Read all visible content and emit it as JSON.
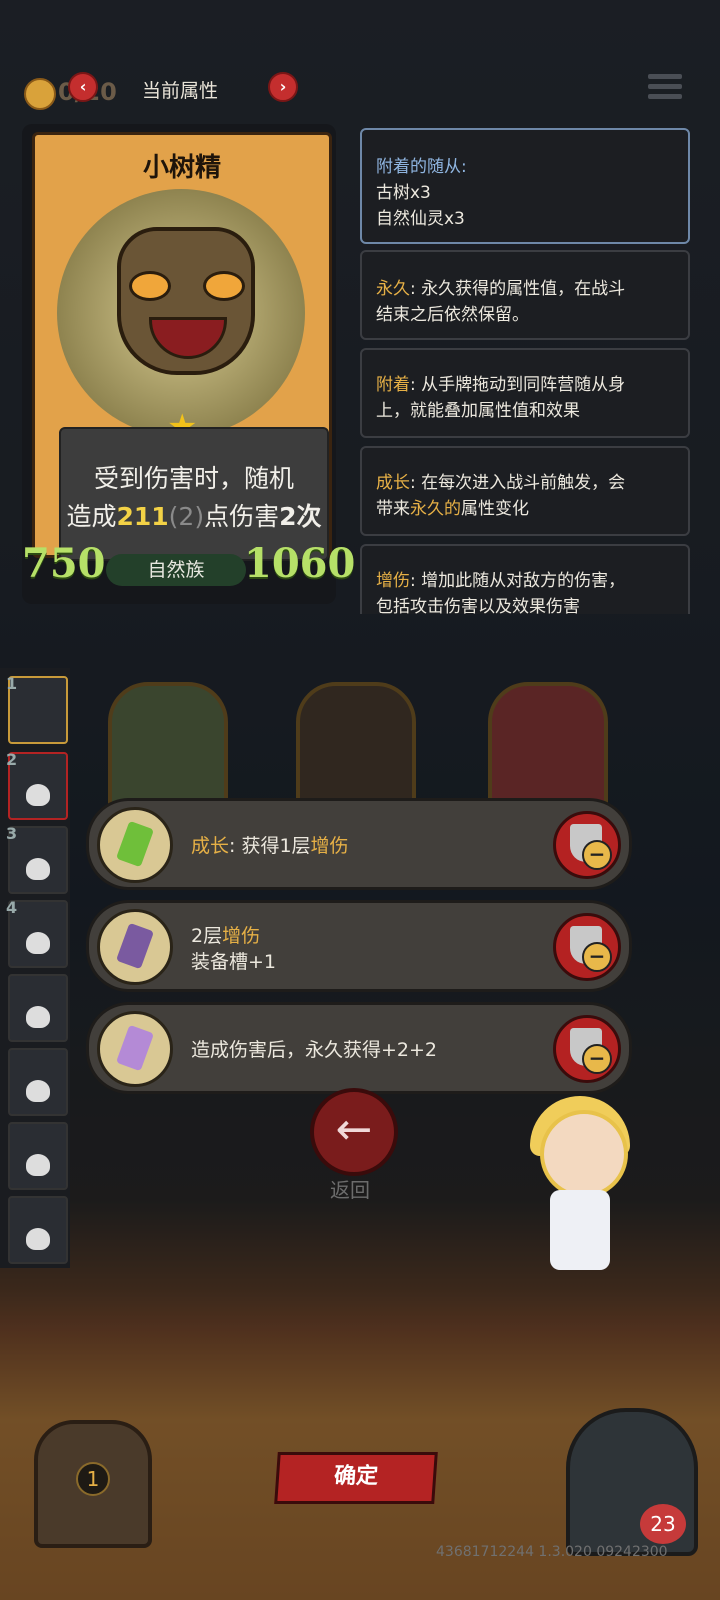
{
  "topbar": {
    "coin_value": "0/20",
    "prev_icon": "‹",
    "next_icon": "›",
    "title": "当前属性"
  },
  "card": {
    "name": "小树精",
    "desc_line1": "受到伤害时，随机",
    "desc_prefix": "造成",
    "desc_damage": "211",
    "desc_base": "(2)",
    "desc_mid": "点伤害",
    "desc_times": "2次",
    "attack": "750",
    "tribe": "自然族",
    "health": "1060"
  },
  "info_panels": [
    {
      "title": "附着的随从:",
      "lines": [
        "古树x3",
        "自然仙灵x3"
      ]
    },
    {
      "keyword": "永久",
      "lines": [
        ": 永久获得的属性值，在战斗",
        "结束之后依然保留。"
      ]
    },
    {
      "keyword": "附着",
      "lines": [
        ": 从手牌拖动到同阵营随从身",
        "上，就能叠加属性值和效果"
      ]
    },
    {
      "keyword": "成长",
      "line1_rest": ": 在每次进入战斗前触发，会",
      "line2_pre": "带来",
      "line2_kw": "永久的",
      "line2_post": "属性变化"
    },
    {
      "keyword": "增伤",
      "lines": [
        ": 增加此随从对敌方的伤害，",
        "包括攻击伤害以及效果伤害"
      ]
    }
  ],
  "roster": [
    "1",
    "2",
    "3",
    "4"
  ],
  "upgrades": [
    {
      "kw": "成长",
      "text_mid": ": 获得1层",
      "kw2": "增伤"
    },
    {
      "line1_pre": "2层",
      "line1_kw": "增伤",
      "line2": "装备槽+1"
    },
    {
      "text": "造成伤害后，永久获得+2+2"
    }
  ],
  "back": {
    "icon": "←",
    "label": "返回"
  },
  "confirm_label": "确定",
  "chest_count": "1",
  "hero_hp": "23",
  "version": "43681712244 1.3.020 09242300",
  "colors": {
    "keyword": "#e6b046",
    "accent_red": "#b42323",
    "stat_green": "#b6e068"
  }
}
